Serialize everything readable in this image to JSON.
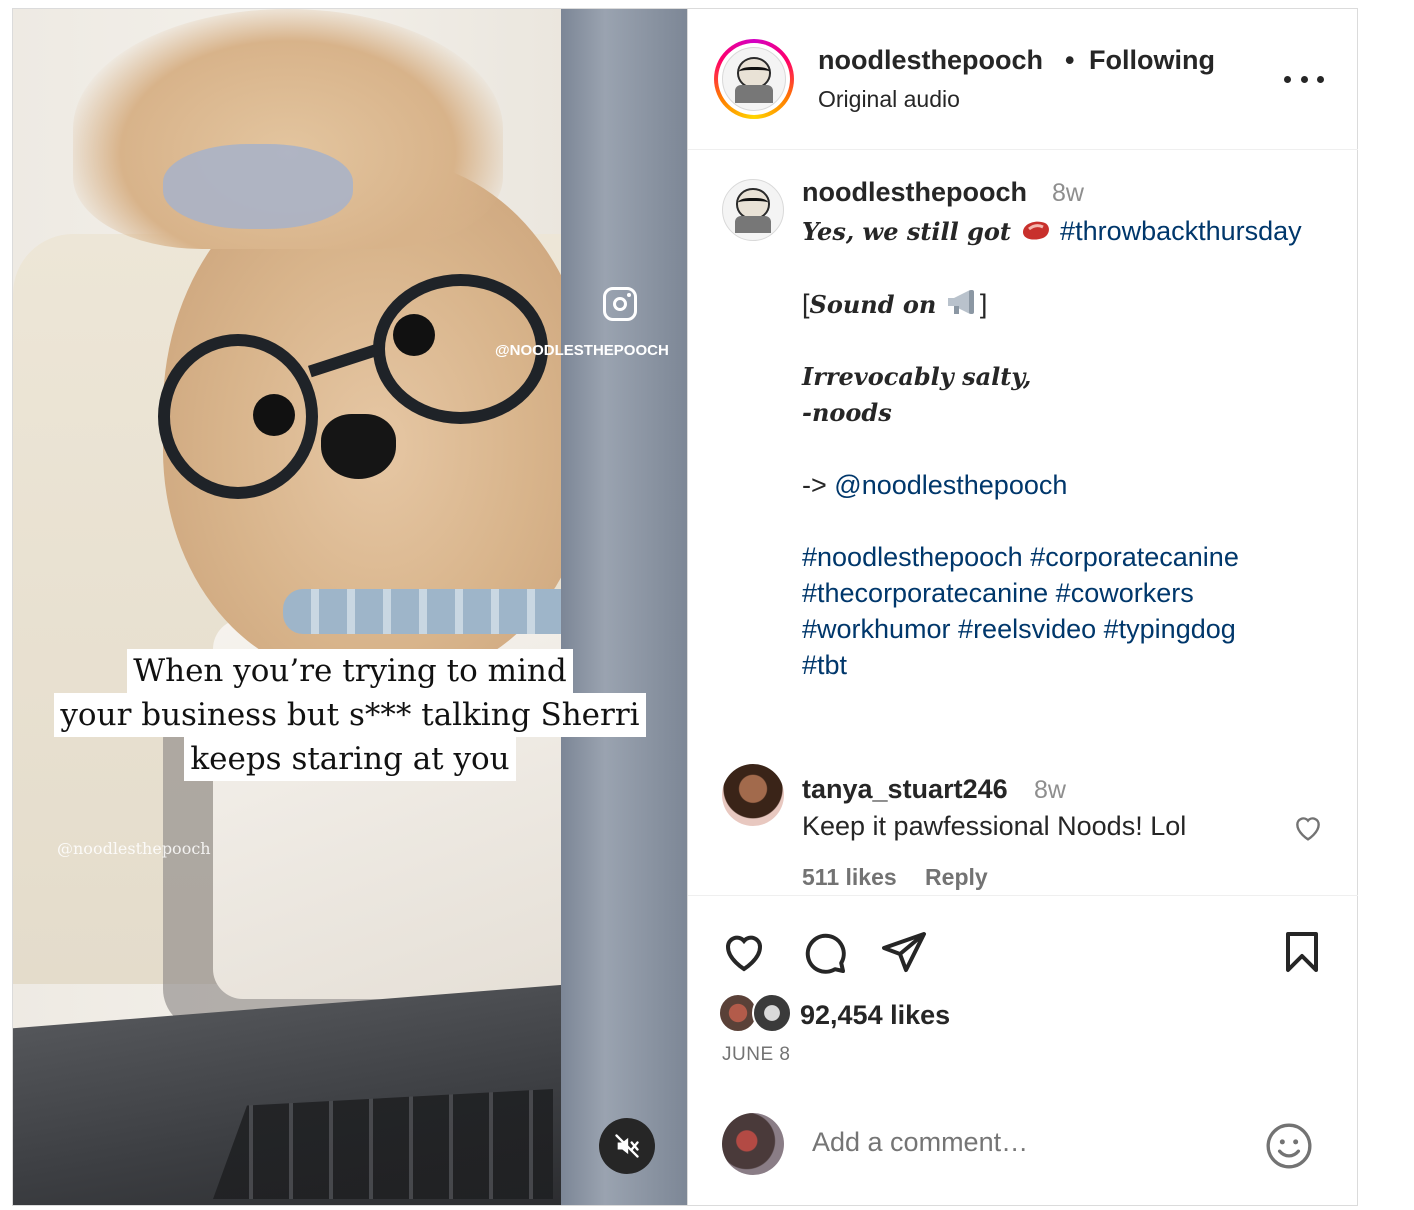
{
  "media": {
    "overlay_lines": [
      "When you’re trying to mind",
      "your business but s*** talking Sherri",
      "keeps staring at you"
    ],
    "watermark_top": "@NOODLESTHEPOOCH",
    "watermark_bottom": "@noodlesthepooch"
  },
  "header": {
    "username": "noodlesthepooch",
    "separator": "•",
    "follow_status": "Following",
    "audio": "Original audio"
  },
  "caption": {
    "username": "noodlesthepooch",
    "time": "8w",
    "line1_text": "Yes, we still got",
    "line1_hashtag": "#throwbackthursday",
    "sound_open": "[",
    "sound_text": "Sound on",
    "sound_close": "]",
    "salty": "Irrevocably salty,",
    "signoff": "-noods",
    "arrow": "->",
    "mention": "@noodlesthepooch",
    "tags_line1": "#noodlesthepooch #corporatecanine",
    "tags_line2": "#thecorporatecanine #coworkers",
    "tags_line3": "#workhumor #reelsvideo #typingdog",
    "tags_line4": "#tbt"
  },
  "comment": {
    "username": "tanya_stuart246",
    "time": "8w",
    "text": "Keep it pawfessional Noods! Lol",
    "likes": "511 likes",
    "reply": "Reply"
  },
  "actions": {
    "likes": "92,454 likes",
    "date": "JUNE 8"
  },
  "add_comment": {
    "placeholder": "Add a comment…"
  },
  "icons": [
    "instagram-icon",
    "mute-icon",
    "more-icon",
    "heart-icon",
    "comment-icon",
    "share-icon",
    "bookmark-icon",
    "emoji-icon",
    "steak-emoji-icon",
    "megaphone-emoji-icon"
  ],
  "colors": {
    "link": "#00376b",
    "secondary_text": "#8e8e8e",
    "text": "#262626"
  }
}
